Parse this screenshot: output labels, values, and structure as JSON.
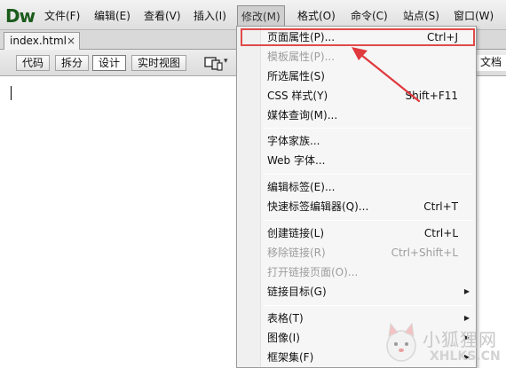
{
  "app": {
    "logo": "Dw"
  },
  "menubar": {
    "items": [
      {
        "label": "文件(F)"
      },
      {
        "label": "编辑(E)"
      },
      {
        "label": "查看(V)"
      },
      {
        "label": "插入(I)"
      },
      {
        "label": "修改(M)"
      },
      {
        "label": "格式(O)"
      },
      {
        "label": "命令(C)"
      },
      {
        "label": "站点(S)"
      },
      {
        "label": "窗口(W)"
      }
    ],
    "active": "修改(M)"
  },
  "document": {
    "tab": "index.html",
    "close_glyph": "×"
  },
  "toolbar": {
    "views": [
      {
        "label": "代码"
      },
      {
        "label": "拆分"
      },
      {
        "label": "设计",
        "active": true
      },
      {
        "label": "实时视图"
      }
    ],
    "device_icon": "multiscreen-icon",
    "tail_text": "文档"
  },
  "dropdown": {
    "items": [
      {
        "label": "页面属性(P)...",
        "shortcut": "Ctrl+J",
        "highlighted": true
      },
      {
        "label": "模板属性(P)...",
        "disabled": true
      },
      {
        "label": "所选属性(S)"
      },
      {
        "label": "CSS 样式(Y)",
        "shortcut": "Shift+F11"
      },
      {
        "label": "媒体查询(M)..."
      },
      {
        "label": "字体家族..."
      },
      {
        "label": "Web 字体..."
      },
      {
        "label": "编辑标签(E)..."
      },
      {
        "label": "快速标签编辑器(Q)...",
        "shortcut": "Ctrl+T"
      },
      {
        "label": "创建链接(L)",
        "shortcut": "Ctrl+L"
      },
      {
        "label": "移除链接(R)",
        "shortcut": "Ctrl+Shift+L",
        "disabled": true
      },
      {
        "label": "打开链接页面(O)...",
        "disabled": true
      },
      {
        "label": "链接目标(G)",
        "submenu": true
      },
      {
        "label": "表格(T)",
        "submenu": true
      },
      {
        "label": "图像(I)",
        "submenu": true
      },
      {
        "label": "框架集(F)",
        "submenu": true
      }
    ],
    "submenu_glyph": "▶"
  },
  "annotation": {
    "color": "#e0393e"
  },
  "watermark": {
    "name": "小狐狸网",
    "site": "XHLKS.CN"
  },
  "colors": {
    "logo": "#1c5b1c",
    "highlight_border": "#e04a4a",
    "disabled_text": "#9d9d9d"
  }
}
